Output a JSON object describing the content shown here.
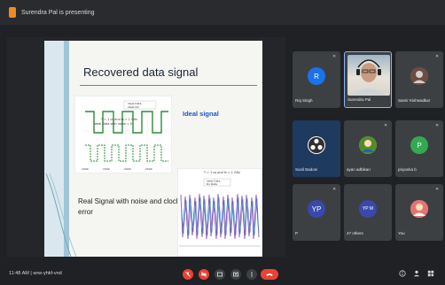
{
  "topbar": {
    "presenting_text": "Surendra Pal is presenting"
  },
  "slide": {
    "title": "Recovered data signal",
    "ideal_label": "Ideal signal",
    "real_label": "Real Signal with noise and clock error",
    "plot1": {
      "legend": [
        "Ideal Data",
        "Ideal Clk"
      ],
      "caption_1": "T = 1 us and fs = 1 GHz",
      "caption_2": "Ideal Data with noise = 0",
      "x_ticks": [
        "1000",
        "1500",
        "2000",
        "2500"
      ]
    },
    "plot2": {
      "legend": [
        "Ideal Data",
        "Rx Data"
      ],
      "caption_1": "T = 1 us and fs = 1 GHz"
    }
  },
  "participants": [
    {
      "name": "Raj Singh",
      "initials": "R",
      "color": "#1a73e8",
      "muted": true
    },
    {
      "name": "Surendra Pal",
      "initials": "",
      "color": "",
      "muted": false,
      "photo": true
    },
    {
      "name": "Samir Kishwadkar",
      "initials": "",
      "color": "#8d6e63",
      "muted": true
    },
    {
      "name": "Sunil Badoni",
      "initials": "",
      "color": "#ffffff",
      "muted": false,
      "active": true
    },
    {
      "name": "ayan adhikari",
      "initials": "",
      "color": "#7cb342",
      "muted": true
    },
    {
      "name": "priyanka b",
      "initials": "P",
      "color": "#34a853",
      "muted": true
    },
    {
      "name": "P",
      "initials": "YP",
      "color": "#3949ab",
      "muted": true
    },
    {
      "name": "47 others",
      "initials": "YP M",
      "color": "#3949ab",
      "muted": false
    },
    {
      "name": "You",
      "initials": "",
      "color": "#ef9a9a",
      "muted": true
    }
  ],
  "bottombar": {
    "time": "11:48 AM",
    "meeting_code": "wrw-yhkf-vnd"
  },
  "colors": {
    "end_call": "#ea4335",
    "accent": "#1a73e8"
  }
}
